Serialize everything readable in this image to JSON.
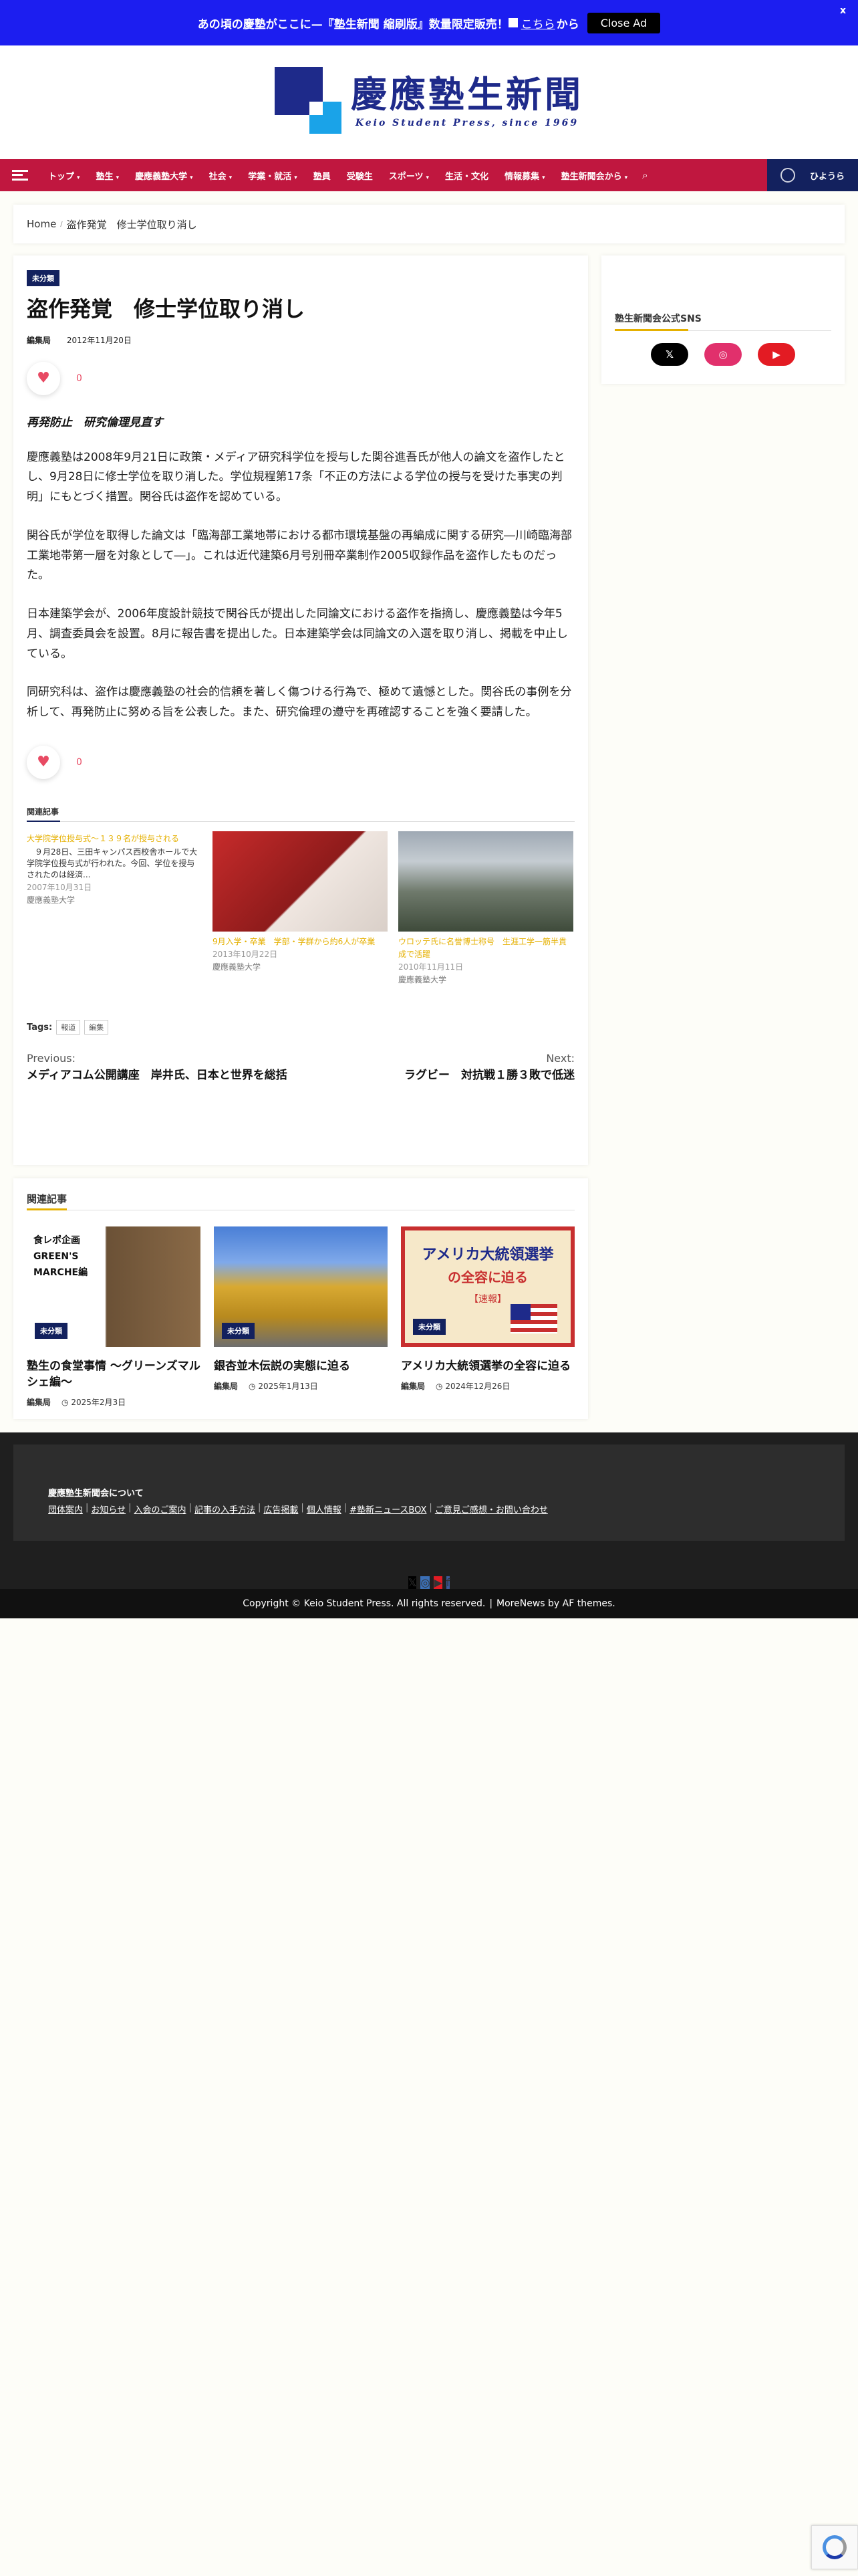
{
  "ad": {
    "text": "あの頃の慶塾がここに—『塾生新聞 縮刷版』数量限定販売！",
    "link": "こちら",
    "suffix": "から",
    "close_label": "Close Ad",
    "x": "x"
  },
  "header": {
    "logo_jp": "慶應塾生新聞",
    "logo_en": "Keio Student Press, since 1969"
  },
  "nav": {
    "items": [
      "トップ",
      "塾生",
      "慶應義塾大学",
      "社会",
      "学業・就活",
      "塾員",
      "受験生",
      "スポーツ",
      "生活・文化",
      "情報募集",
      "塾生新聞会から"
    ],
    "has_caret": [
      true,
      true,
      true,
      true,
      true,
      false,
      false,
      true,
      false,
      true,
      true
    ],
    "right_label": "ひようら"
  },
  "breadcrumb": {
    "home": "Home",
    "current": "盗作発覚　修士学位取り消し"
  },
  "article": {
    "category": "未分類",
    "title": "盗作発覚　修士学位取り消し",
    "author": "編集局",
    "date": "2012年11月20日",
    "like_count": "0",
    "lead": "再発防止　研究倫理見直す",
    "paragraphs": [
      "慶應義塾は2008年9月21日に政策・メディア研究科学位を授与した関谷進吾氏が他人の論文を盗作したとし、9月28日に修士学位を取り消した。学位規程第17条「不正の方法による学位の授与を受けた事実の判明」にもとづく措置。関谷氏は盗作を認めている。",
      "関谷氏が学位を取得した論文は「臨海部工業地帯における都市環境基盤の再編成に関する研究―川崎臨海部工業地帯第一層を対象として―」。これは近代建築6月号別冊卒業制作2005収録作品を盗作したものだった。",
      "日本建築学会が、2006年度設計競技で関谷氏が提出した同論文における盗作を指摘し、慶應義塾は今年5月、調査委員会を設置。8月に報告書を提出した。日本建築学会は同論文の入選を取り消し、掲載を中止している。",
      "同研究科は、盗作は慶應義塾の社会的信頼を著しく傷つける行為で、極めて遺憾とした。関谷氏の事例を分析して、再発防止に努める旨を公表した。また、研究倫理の遵守を再確認することを強く要請した。"
    ],
    "related_heading": "関連記事",
    "related": [
      {
        "title": "大学院学位授与式〜１３９名が授与される",
        "excerpt": "　９月28日、三田キャンパス西校舎ホールで大学院学位授与式が行われた。今回、学位を授与されたのは経済...",
        "date": "2007年10月31日",
        "cat": "慶應義塾大学"
      },
      {
        "title": "9月入学・卒業　学部・学群から約6人が卒業",
        "excerpt": "",
        "date": "2013年10月22日",
        "cat": "慶應義塾大学"
      },
      {
        "title": "ウロッテ氏に名誉博士称号　生涯工学一筋半貴成で活躍",
        "excerpt": "",
        "date": "2010年11月11日",
        "cat": "慶應義塾大学"
      }
    ],
    "tags_label": "Tags:",
    "tags": [
      "報道",
      "編集"
    ],
    "prev_label": "Previous:",
    "prev_title": "メディアコム公開講座　岸井氏、日本と世界を総括",
    "next_label": "Next:",
    "next_title": "ラグビー　対抗戦１勝３敗で低迷"
  },
  "sidebar": {
    "sns_title": "塾生新聞会公式SNS",
    "sns": [
      {
        "name": "x",
        "glyph": "𝕏",
        "color": "#000000"
      },
      {
        "name": "instagram",
        "glyph": "◎",
        "color": "#e1306c"
      },
      {
        "name": "youtube",
        "glyph": "▶",
        "color": "#e31b23"
      }
    ]
  },
  "more": {
    "heading": "関連記事",
    "items": [
      {
        "title": "塾生の食堂事情 〜グリーンズマルシェ編〜",
        "author": "編集局",
        "date": "2025年2月3日",
        "badge": "未分類",
        "img_line1": "食レポ企画",
        "img_line2": "GREEN'S",
        "img_line3": "MARCHE編"
      },
      {
        "title": "銀杏並木伝説の実態に迫る",
        "author": "編集局",
        "date": "2025年1月13日",
        "badge": "未分類"
      },
      {
        "title": "アメリカ大統領選挙の全容に迫る",
        "author": "編集局",
        "date": "2024年12月26日",
        "badge": "未分類",
        "img_line1": "アメリカ大統領選挙",
        "img_line2": "の全容に迫る",
        "img_line3": "【速報】"
      }
    ]
  },
  "footer": {
    "heading": "慶應塾生新聞会について",
    "links": [
      "団体案内",
      "お知らせ",
      "入会のご案内",
      "記事の入手方法",
      "広告掲載",
      "個人情報",
      "#塾新ニュースBOX",
      "ご意見ご感想・お問い合わせ"
    ],
    "sns": [
      {
        "glyph": "𝕏",
        "color": "#000000"
      },
      {
        "glyph": "◎",
        "color": "#3b6fb6"
      },
      {
        "glyph": "▶",
        "color": "#e31b23"
      },
      {
        "glyph": "f",
        "color": "#3b5998"
      }
    ],
    "copyright": "Copyright © Keio Student Press. All rights reserved.",
    "theme": "MoreNews by AF themes."
  }
}
